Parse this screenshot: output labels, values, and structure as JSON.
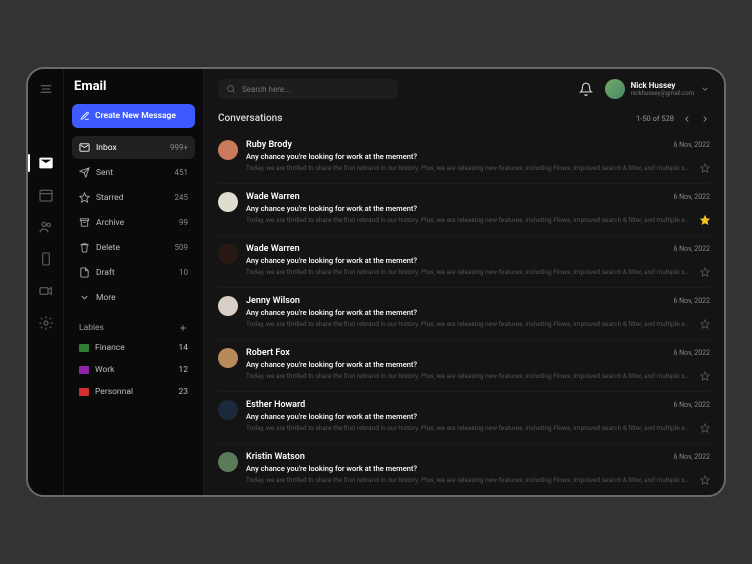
{
  "app_title": "Email",
  "create_button": "Create New Message",
  "search": {
    "placeholder": "Search here..."
  },
  "user": {
    "name": "Nick Hussey",
    "email": "nickhussey@gmail.com"
  },
  "folders": [
    {
      "id": "inbox",
      "label": "Inbox",
      "count": "999+",
      "active": true
    },
    {
      "id": "sent",
      "label": "Sent",
      "count": "451"
    },
    {
      "id": "starred",
      "label": "Starred",
      "count": "245"
    },
    {
      "id": "archive",
      "label": "Archive",
      "count": "99"
    },
    {
      "id": "delete",
      "label": "Delete",
      "count": "509"
    },
    {
      "id": "draft",
      "label": "Draft",
      "count": "10"
    },
    {
      "id": "more",
      "label": "More",
      "count": ""
    }
  ],
  "labels_header": "Lables",
  "labels": [
    {
      "label": "Finance",
      "count": "14",
      "color": "#2e7d32"
    },
    {
      "label": "Work",
      "count": "12",
      "color": "#8e24aa"
    },
    {
      "label": "Personnal",
      "count": "23",
      "color": "#d32f2f"
    }
  ],
  "list": {
    "title": "Conversations",
    "page_info": "1-50 of 528"
  },
  "conversations": [
    {
      "name": "Ruby Brody",
      "date": "6 Nov, 2022",
      "subject": "Any chance you're looking for work at the mement?",
      "preview": "Today, we are thrilled to share the first rebrand in our history. Plus, we are releasing new features, including Flows, improved search & filter, and multiple screens download...",
      "starred": false,
      "avatar_bg": "#c97a5a"
    },
    {
      "name": "Wade Warren",
      "date": "6 Nov, 2022",
      "subject": "Any chance you're looking for work at the mement?",
      "preview": "Today, we are thrilled to share the first rebrand in our history. Plus, we are releasing new features, including Flows, improved search & filter, and multiple screens download...",
      "starred": true,
      "avatar_bg": "#e0dcd0"
    },
    {
      "name": "Wade Warren",
      "date": "6 Nov, 2022",
      "subject": "Any chance you're looking for work at the mement?",
      "preview": "Today, we are thrilled to share the first rebrand in our history. Plus, we are releasing new features, including Flows, improved search & filter, and multiple screens download...",
      "starred": false,
      "avatar_bg": "#2a1815"
    },
    {
      "name": "Jenny Wilson",
      "date": "6 Nov, 2022",
      "subject": "Any chance you're looking for work at the mement?",
      "preview": "Today, we are thrilled to share the first rebrand in our history. Plus, we are releasing new features, including Flows, improved search & filter, and multiple screens download...",
      "starred": false,
      "avatar_bg": "#d8cfc7"
    },
    {
      "name": "Robert Fox",
      "date": "6 Nov, 2022",
      "subject": "Any chance you're looking for work at the mement?",
      "preview": "Today, we are thrilled to share the first rebrand in our history. Plus, we are releasing new features, including Flows, improved search & filter, and multiple screens download...",
      "starred": false,
      "avatar_bg": "#b88a5a"
    },
    {
      "name": "Esther Howard",
      "date": "6 Nov, 2022",
      "subject": "Any chance you're looking for work at the mement?",
      "preview": "Today, we are thrilled to share the first rebrand in our history. Plus, we are releasing new features, including Flows, improved search & filter, and multiple screens download...",
      "starred": false,
      "avatar_bg": "#1a2a3a"
    },
    {
      "name": "Kristin Watson",
      "date": "6 Nov, 2022",
      "subject": "Any chance you're looking for work at the mement?",
      "preview": "Today, we are thrilled to share the first rebrand in our history. Plus, we are releasing new features, including Flows, improved search & filter, and multiple screens download...",
      "starred": false,
      "avatar_bg": "#5a7a5a"
    }
  ]
}
